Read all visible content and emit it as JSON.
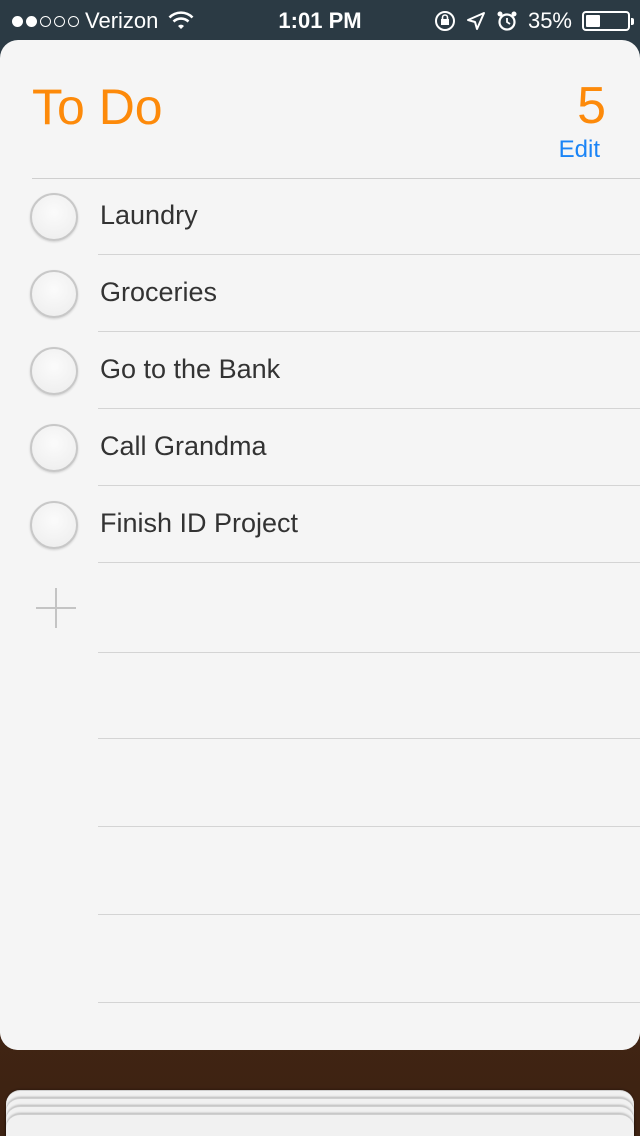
{
  "status_bar": {
    "carrier": "Verizon",
    "time": "1:01 PM",
    "battery": "35%",
    "battery_level": 0.35,
    "signal_bars_filled": 2,
    "signal_bars_total": 5,
    "icons": [
      "wifi-icon",
      "rotation-lock-icon",
      "location-arrow-icon",
      "alarm-icon",
      "battery-icon"
    ]
  },
  "list": {
    "title": "To Do",
    "count": "5",
    "edit_label": "Edit",
    "items": [
      {
        "label": "Laundry"
      },
      {
        "label": "Groceries"
      },
      {
        "label": "Go to the Bank"
      },
      {
        "label": "Call Grandma"
      },
      {
        "label": "Finish ID Project"
      }
    ],
    "add_icon": "plus-icon"
  },
  "colors": {
    "accent": "#fd8a0a",
    "link": "#1a84f6",
    "status_bar_bg": "#2b3a44"
  }
}
